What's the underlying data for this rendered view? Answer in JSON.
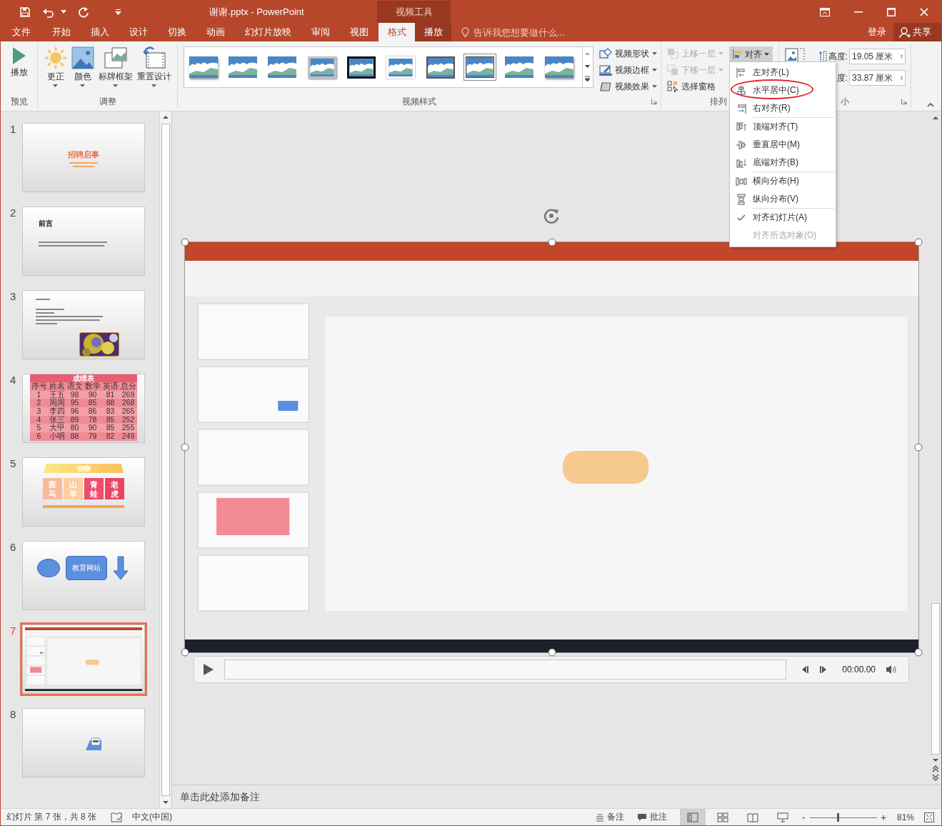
{
  "title_bar": {
    "title": "谢谢.pptx - PowerPoint",
    "context_group": "视频工具"
  },
  "tabs": [
    {
      "label": "文件",
      "kind": "file",
      "selected": false
    },
    {
      "label": "开始",
      "kind": "normal",
      "selected": false
    },
    {
      "label": "插入",
      "kind": "normal",
      "selected": false
    },
    {
      "label": "设计",
      "kind": "normal",
      "selected": false
    },
    {
      "label": "切换",
      "kind": "normal",
      "selected": false
    },
    {
      "label": "动画",
      "kind": "normal",
      "selected": false
    },
    {
      "label": "幻灯片放映",
      "kind": "normal",
      "selected": false
    },
    {
      "label": "审阅",
      "kind": "normal",
      "selected": false
    },
    {
      "label": "视图",
      "kind": "normal",
      "selected": false
    },
    {
      "label": "格式",
      "kind": "context",
      "selected": true
    },
    {
      "label": "播放",
      "kind": "context",
      "selected": false
    }
  ],
  "tell_me": {
    "placeholder": "告诉我您想要做什么..."
  },
  "account": {
    "sign_in": "登录",
    "share": "共享"
  },
  "ribbon": {
    "preview": {
      "label": "预览",
      "button": "播放"
    },
    "adjust": {
      "label": "调整",
      "buttons": [
        {
          "label": "更正",
          "kind": "sun"
        },
        {
          "label": "颜色",
          "kind": "color"
        },
        {
          "label": "标牌框架",
          "kind": "poster"
        },
        {
          "label": "重置设计",
          "kind": "reset"
        }
      ]
    },
    "video_styles": {
      "label": "视频样式",
      "gallery": [
        {
          "kind": "shadow",
          "selected": false
        },
        {
          "kind": "plain",
          "selected": false
        },
        {
          "kind": "soft",
          "selected": false
        },
        {
          "kind": "gray-frame",
          "selected": false
        },
        {
          "kind": "black-frame",
          "selected": false
        },
        {
          "kind": "white-frame",
          "selected": false
        },
        {
          "kind": "dark-frame",
          "selected": false
        },
        {
          "kind": "thin-frame",
          "selected": true
        },
        {
          "kind": "plain",
          "selected": false
        },
        {
          "kind": "shadow",
          "selected": false
        }
      ],
      "commands": [
        {
          "label": "视频形状",
          "kind": "shape"
        },
        {
          "label": "视频边框",
          "kind": "border"
        },
        {
          "label": "视频效果",
          "kind": "effect"
        }
      ]
    },
    "arrange": {
      "label": "排列",
      "items": [
        {
          "label": "上移一层",
          "kind": "forward",
          "disabled": true
        },
        {
          "label": "下移一层",
          "kind": "backward",
          "disabled": true
        },
        {
          "label": "选择窗格",
          "kind": "pane",
          "disabled": false
        }
      ],
      "align": {
        "label": "对齐",
        "expanded": true
      }
    },
    "size": {
      "label": "小",
      "height_label": "高度:",
      "height": "19.05 厘米",
      "width_label": "度:",
      "width": "33.87 厘米"
    }
  },
  "align_menu": [
    {
      "label": "左对齐(L)",
      "kind": "align-left",
      "separator_before": false,
      "checked": false,
      "disabled": false,
      "circled": false
    },
    {
      "label": "水平居中(C)",
      "kind": "align-center",
      "separator_before": false,
      "checked": false,
      "disabled": false,
      "circled": true
    },
    {
      "label": "右对齐(R)",
      "kind": "align-right",
      "separator_before": false,
      "checked": false,
      "disabled": false,
      "circled": false
    },
    {
      "label": "顶端对齐(T)",
      "kind": "align-top",
      "separator_before": true,
      "checked": false,
      "disabled": false,
      "circled": false
    },
    {
      "label": "垂直居中(M)",
      "kind": "align-middle",
      "separator_before": false,
      "checked": false,
      "disabled": false,
      "circled": false
    },
    {
      "label": "底端对齐(B)",
      "kind": "align-bottom",
      "separator_before": false,
      "checked": false,
      "disabled": false,
      "circled": false
    },
    {
      "label": "横向分布(H)",
      "kind": "distribute-h",
      "separator_before": true,
      "checked": false,
      "disabled": false,
      "circled": false
    },
    {
      "label": "纵向分布(V)",
      "kind": "distribute-v",
      "separator_before": false,
      "checked": false,
      "disabled": false,
      "circled": false
    },
    {
      "label": "对齐幻灯片(A)",
      "kind": "toggle",
      "separator_before": true,
      "checked": true,
      "disabled": false,
      "circled": false
    },
    {
      "label": "对齐所选对象(O)",
      "kind": "toggle",
      "separator_before": false,
      "checked": false,
      "disabled": true,
      "circled": false
    }
  ],
  "slides": [
    {
      "number": "1",
      "selected": false,
      "kind": "title",
      "title": "招聘启事"
    },
    {
      "number": "2",
      "selected": false,
      "kind": "text",
      "title": "前言"
    },
    {
      "number": "3",
      "selected": false,
      "kind": "text-picture"
    },
    {
      "number": "4",
      "selected": false,
      "kind": "table",
      "title": "成绩表",
      "header": [
        "序号",
        "姓名",
        "语文",
        "数学",
        "英语",
        "总分"
      ],
      "rows": [
        [
          "1",
          "王五",
          "98",
          "90",
          "81",
          "269"
        ],
        [
          "2",
          "周周",
          "95",
          "85",
          "88",
          "268"
        ],
        [
          "3",
          "李四",
          "96",
          "86",
          "83",
          "265"
        ],
        [
          "4",
          "张三",
          "89",
          "78",
          "85",
          "252"
        ],
        [
          "5",
          "大甲",
          "80",
          "90",
          "85",
          "255"
        ],
        [
          "6",
          "小明",
          "88",
          "79",
          "82",
          "249"
        ]
      ]
    },
    {
      "number": "5",
      "selected": false,
      "kind": "cards",
      "title": "动物",
      "cards": [
        {
          "text": "斑马",
          "color": "#f9b99a"
        },
        {
          "text": "山羊",
          "color": "#fbcf9f"
        },
        {
          "text": "青蛙",
          "color": "#ef4d6a"
        },
        {
          "text": "老虎",
          "color": "#e94560"
        }
      ]
    },
    {
      "number": "6",
      "selected": false,
      "kind": "shapes",
      "label": "教育网站"
    },
    {
      "number": "7",
      "selected": true,
      "kind": "video"
    },
    {
      "number": "8",
      "selected": false,
      "kind": "icon"
    }
  ],
  "player": {
    "time": "00:00.00"
  },
  "notes": {
    "placeholder": "单击此处添加备注"
  },
  "status_bar": {
    "slide_info": "幻灯片 第 7 张，共 8 张",
    "language": "中文(中国)",
    "notes": "备注",
    "comments": "批注",
    "views": [
      {
        "kind": "normal",
        "selected": true
      },
      {
        "kind": "sorter",
        "selected": false
      },
      {
        "kind": "reading",
        "selected": false
      },
      {
        "kind": "show",
        "selected": false
      }
    ],
    "zoom": {
      "minus": "-",
      "plus": "+",
      "level": 0.4,
      "reading": "81%"
    }
  }
}
